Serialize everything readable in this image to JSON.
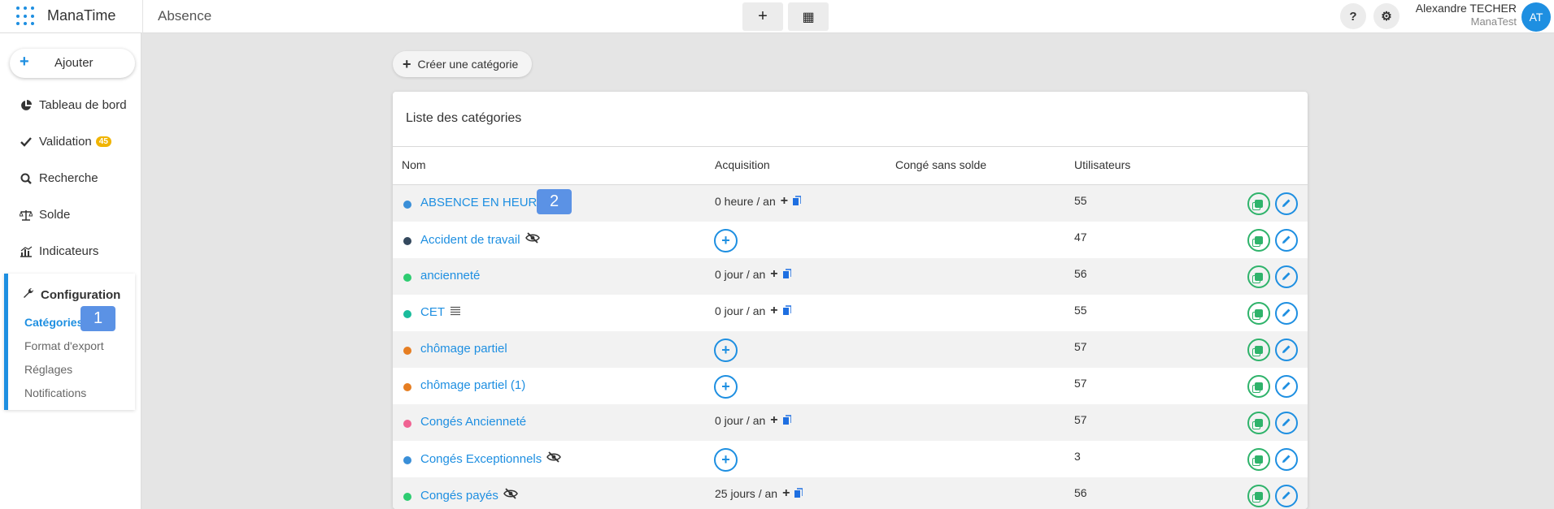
{
  "app": {
    "brand": "ManaTime",
    "section": "Absence"
  },
  "topbar": {
    "add_icon": "+",
    "calendar_icon": "▦",
    "help_icon": "?",
    "settings_icon": "⚙",
    "user_name": "Alexandre TECHER",
    "user_company": "ManaTest",
    "avatar_initials": "AT"
  },
  "sidebar": {
    "add_button": "Ajouter",
    "items": [
      {
        "label": "Tableau de bord",
        "icon": "pie-chart-icon"
      },
      {
        "label": "Validation",
        "icon": "check-icon",
        "badge": "45"
      },
      {
        "label": "Recherche",
        "icon": "search-icon"
      },
      {
        "label": "Solde",
        "icon": "balance-scale-icon"
      },
      {
        "label": "Indicateurs",
        "icon": "bar-chart-icon"
      }
    ],
    "config": {
      "title": "Configuration",
      "items": [
        "Catégories",
        "Format d'export",
        "Réglages",
        "Notifications"
      ]
    },
    "callout": "1"
  },
  "main": {
    "create_button": "Créer une catégorie",
    "card_title": "Liste des catégories",
    "columns": [
      "Nom",
      "Acquisition",
      "Congé sans solde",
      "Utilisateurs"
    ],
    "callout": "2",
    "rows": [
      {
        "name": "ABSENCE EN HEURE",
        "color": "#3a8fd8",
        "acquisition": "0 heure / an",
        "users": "55",
        "icon": ""
      },
      {
        "name": "Accident de travail",
        "color": "#34495e",
        "acquisition": "",
        "users": "47",
        "icon": "eye-slash"
      },
      {
        "name": "ancienneté",
        "color": "#2ecc71",
        "acquisition": "0 jour / an",
        "users": "56",
        "icon": ""
      },
      {
        "name": "CET",
        "color": "#1abc9c",
        "acquisition": "0 jour / an",
        "users": "55",
        "icon": "list"
      },
      {
        "name": "chômage partiel",
        "color": "#e67e22",
        "acquisition": "",
        "users": "57",
        "icon": ""
      },
      {
        "name": "chômage partiel (1)",
        "color": "#e67e22",
        "acquisition": "",
        "users": "57",
        "icon": ""
      },
      {
        "name": "Congés Ancienneté",
        "color": "#f06292",
        "acquisition": "0 jour / an",
        "users": "57",
        "icon": ""
      },
      {
        "name": "Congés Exceptionnels",
        "color": "#3a8fd8",
        "acquisition": "",
        "users": "3",
        "icon": "eye-slash"
      },
      {
        "name": "Congés payés",
        "color": "#2ecc71",
        "acquisition": "25 jours / an",
        "users": "56",
        "icon": "eye-slash"
      }
    ]
  }
}
